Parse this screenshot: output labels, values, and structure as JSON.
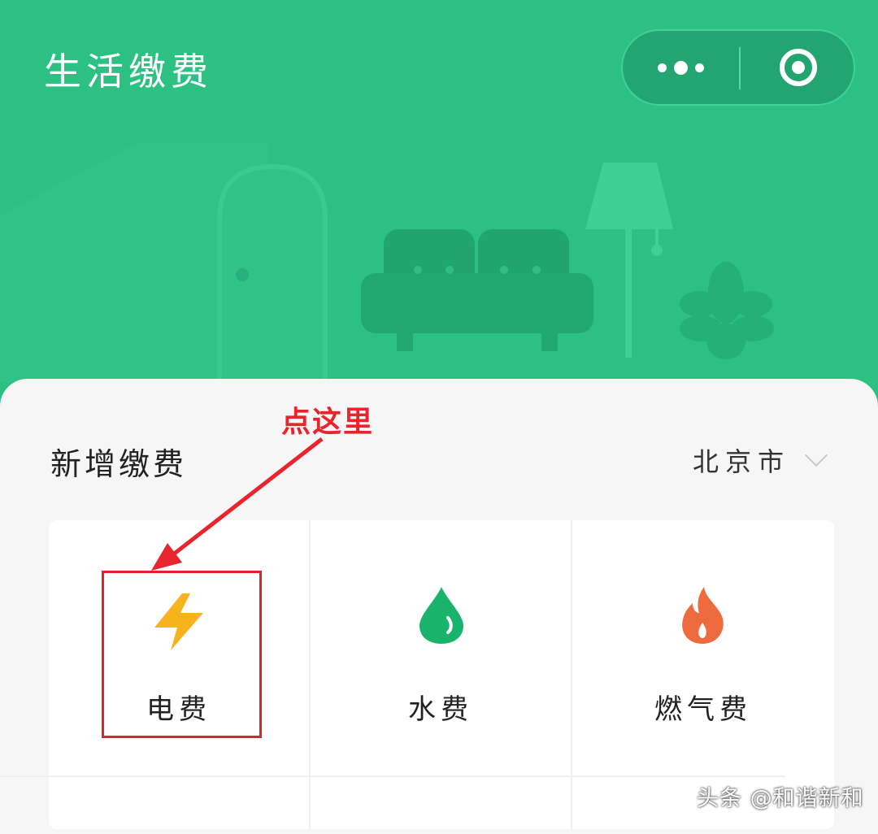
{
  "header": {
    "title": "生活缴费",
    "accent_color": "#2cc083"
  },
  "capsule": {
    "more_icon": "more-dots-icon",
    "close_icon": "target-close-icon"
  },
  "section": {
    "title": "新增缴费",
    "city": "北京市"
  },
  "services": [
    {
      "label": "电费",
      "icon": "lightning-icon",
      "color": "#f7b31c"
    },
    {
      "label": "水费",
      "icon": "water-drop-icon",
      "color": "#19b36b"
    },
    {
      "label": "燃气费",
      "icon": "flame-icon",
      "color": "#ee6a3f"
    }
  ],
  "annotation": {
    "text": "点这里",
    "color": "#e8242d"
  },
  "watermark": "头条 @和谐新和"
}
